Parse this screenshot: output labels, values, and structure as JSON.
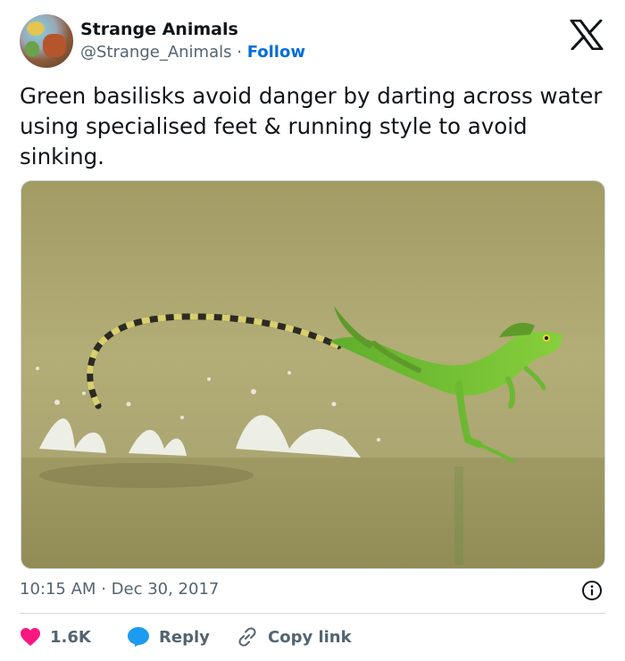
{
  "author": {
    "name": "Strange Animals",
    "handle": "@Strange_Animals",
    "separator": "·",
    "follow_label": "Follow"
  },
  "tweet": {
    "text": "Green basilisks avoid danger by darting across water using specialised feet & running style to avoid sinking.",
    "time": "10:15 AM",
    "meta_separator": "·",
    "date": "Dec 30, 2017"
  },
  "media": {
    "description_icon": "photo-basilisk-running-on-water"
  },
  "actions": {
    "like_count": "1.6K",
    "reply_label": "Reply",
    "copy_link_label": "Copy link"
  },
  "colors": {
    "like": "#f91880",
    "reply": "#1d9bf0",
    "follow": "#006fd6",
    "muted": "#536471"
  }
}
